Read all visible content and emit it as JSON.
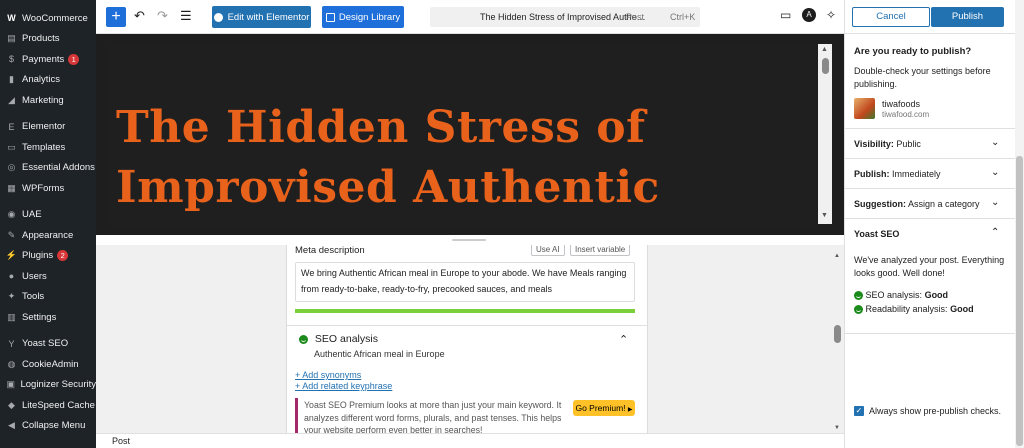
{
  "wp_menu": [
    {
      "label": "WooCommerce",
      "icon": "woo-icon"
    },
    {
      "label": "Products",
      "icon": "archive-icon"
    },
    {
      "label": "Payments",
      "icon": "dollar-icon",
      "badge": "1"
    },
    {
      "label": "Analytics",
      "icon": "bar-chart-icon"
    },
    {
      "label": "Marketing",
      "icon": "megaphone-icon"
    },
    {
      "label": "Elementor",
      "icon": "elementor-icon"
    },
    {
      "label": "Templates",
      "icon": "folder-icon"
    },
    {
      "label": "Essential Addons",
      "icon": "ea-icon"
    },
    {
      "label": "WPForms",
      "icon": "form-icon"
    },
    {
      "label": "UAE",
      "icon": "uae-icon"
    },
    {
      "label": "Appearance",
      "icon": "brush-icon"
    },
    {
      "label": "Plugins",
      "icon": "plug-icon",
      "badge": "2"
    },
    {
      "label": "Users",
      "icon": "user-icon"
    },
    {
      "label": "Tools",
      "icon": "wrench-icon"
    },
    {
      "label": "Settings",
      "icon": "settings-icon"
    },
    {
      "label": "Yoast SEO",
      "icon": "yoast-icon"
    },
    {
      "label": "CookieAdmin",
      "icon": "cookie-icon"
    },
    {
      "label": "Loginizer Security",
      "icon": "lock-icon"
    },
    {
      "label": "LiteSpeed Cache",
      "icon": "diamond-icon"
    },
    {
      "label": "Collapse Menu",
      "icon": "collapse-icon"
    }
  ],
  "toolbar": {
    "edit_elementor": "Edit with Elementor",
    "design_library": "Design Library",
    "command_title": "The Hidden Stress of Improvised Authe…",
    "command_type": "Post",
    "command_shortcut": "Ctrl+K"
  },
  "canvas": {
    "title_line1": "The Hidden Stress of",
    "title_line2": "Improvised Authentic African"
  },
  "meta_box": {
    "label": "Meta description",
    "use_ai": "Use AI",
    "insert_variable": "Insert variable",
    "description": "We bring Authentic African meal in Europe to your abode. We have Meals ranging from ready-to-bake, ready-to-fry, precooked sauces, and meals",
    "seo_analysis": "SEO analysis",
    "keyphrase": "Authentic African meal in Europe",
    "add_synonyms": "+ Add synonyms",
    "add_related": "+ Add related keyphrase",
    "premium_text": "Yoast SEO Premium looks at more than just your main keyword. It analyzes different word forms, plurals, and past tenses. This helps your website perform even better in searches!",
    "go_premium": "Go Premium!"
  },
  "footer": {
    "breadcrumb": "Post"
  },
  "publish_panel": {
    "cancel": "Cancel",
    "publish": "Publish",
    "question": "Are you ready to publish?",
    "description": "Double-check your settings before publishing.",
    "site_name": "tiwafoods",
    "site_url": "tiwafood.com",
    "visibility_label": "Visibility:",
    "visibility_value": "Public",
    "publish_label": "Publish:",
    "publish_value": "Immediately",
    "suggestion_label": "Suggestion:",
    "suggestion_value": "Assign a category",
    "yoast_title": "Yoast SEO",
    "yoast_body": "We've analyzed your post. Everything looks good. Well done!",
    "seo_analysis_label": "SEO analysis:",
    "seo_analysis_value": "Good",
    "readability_label": "Readability analysis:",
    "readability_value": "Good",
    "prepublish_checks": "Always show pre-publish checks."
  }
}
